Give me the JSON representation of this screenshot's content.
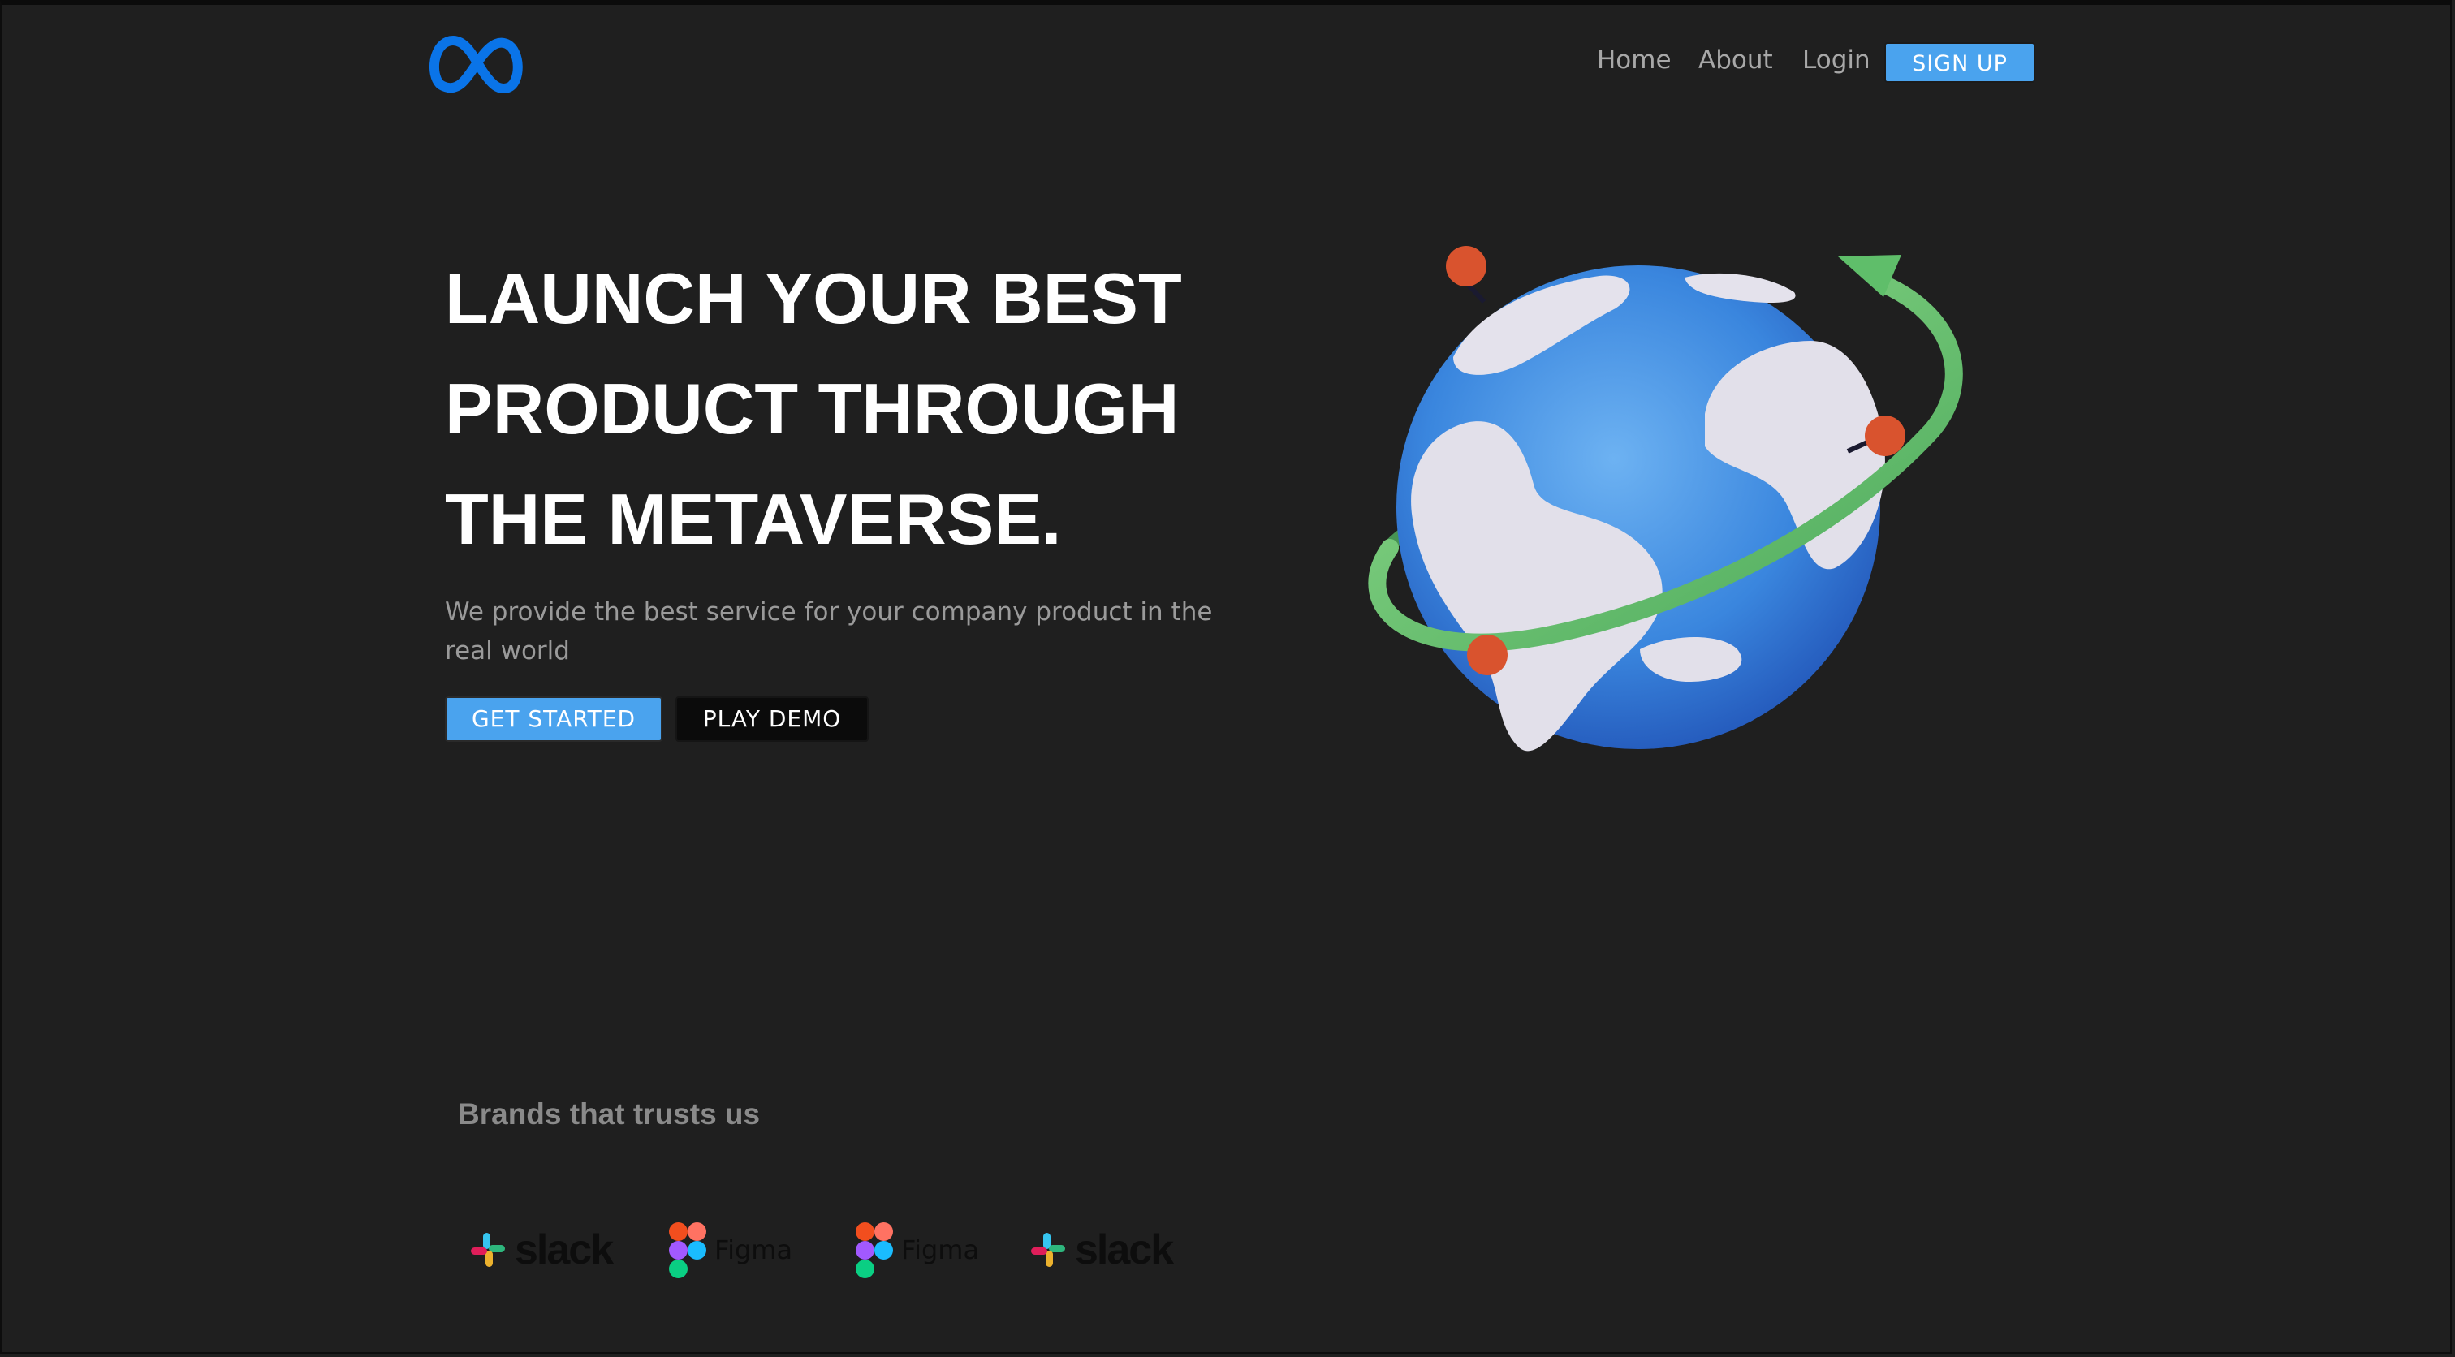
{
  "header": {
    "logo_icon": "meta-infinity-logo-icon",
    "nav": {
      "home": "Home",
      "about": "About",
      "login": "Login",
      "signup": "SIGN UP"
    }
  },
  "hero": {
    "title_lines": [
      "LAUNCH YOUR BEST",
      "PRODUCT THROUGH",
      "THE METAVERSE."
    ],
    "subtitle": "We provide the best service for your company product in the real world",
    "primary_button": "GET STARTED",
    "secondary_button": "PLAY DEMO",
    "illustration_icon": "globe-with-orbit-arrow-icon"
  },
  "brands": {
    "title": "Brands that trusts us",
    "logos": [
      {
        "name": "slack",
        "icon": "slack-icon"
      },
      {
        "name": "Figma",
        "icon": "figma-icon"
      },
      {
        "name": "Figma",
        "icon": "figma-icon"
      },
      {
        "name": "slack",
        "icon": "slack-icon"
      }
    ]
  },
  "colors": {
    "background": "#1f1f1f",
    "accent": "#4aa3ee",
    "logo_blue": "#0a74e8",
    "globe_blue": "#3d8ae0",
    "orbit_green": "#5fbe6a",
    "pin_red": "#d9532e"
  }
}
